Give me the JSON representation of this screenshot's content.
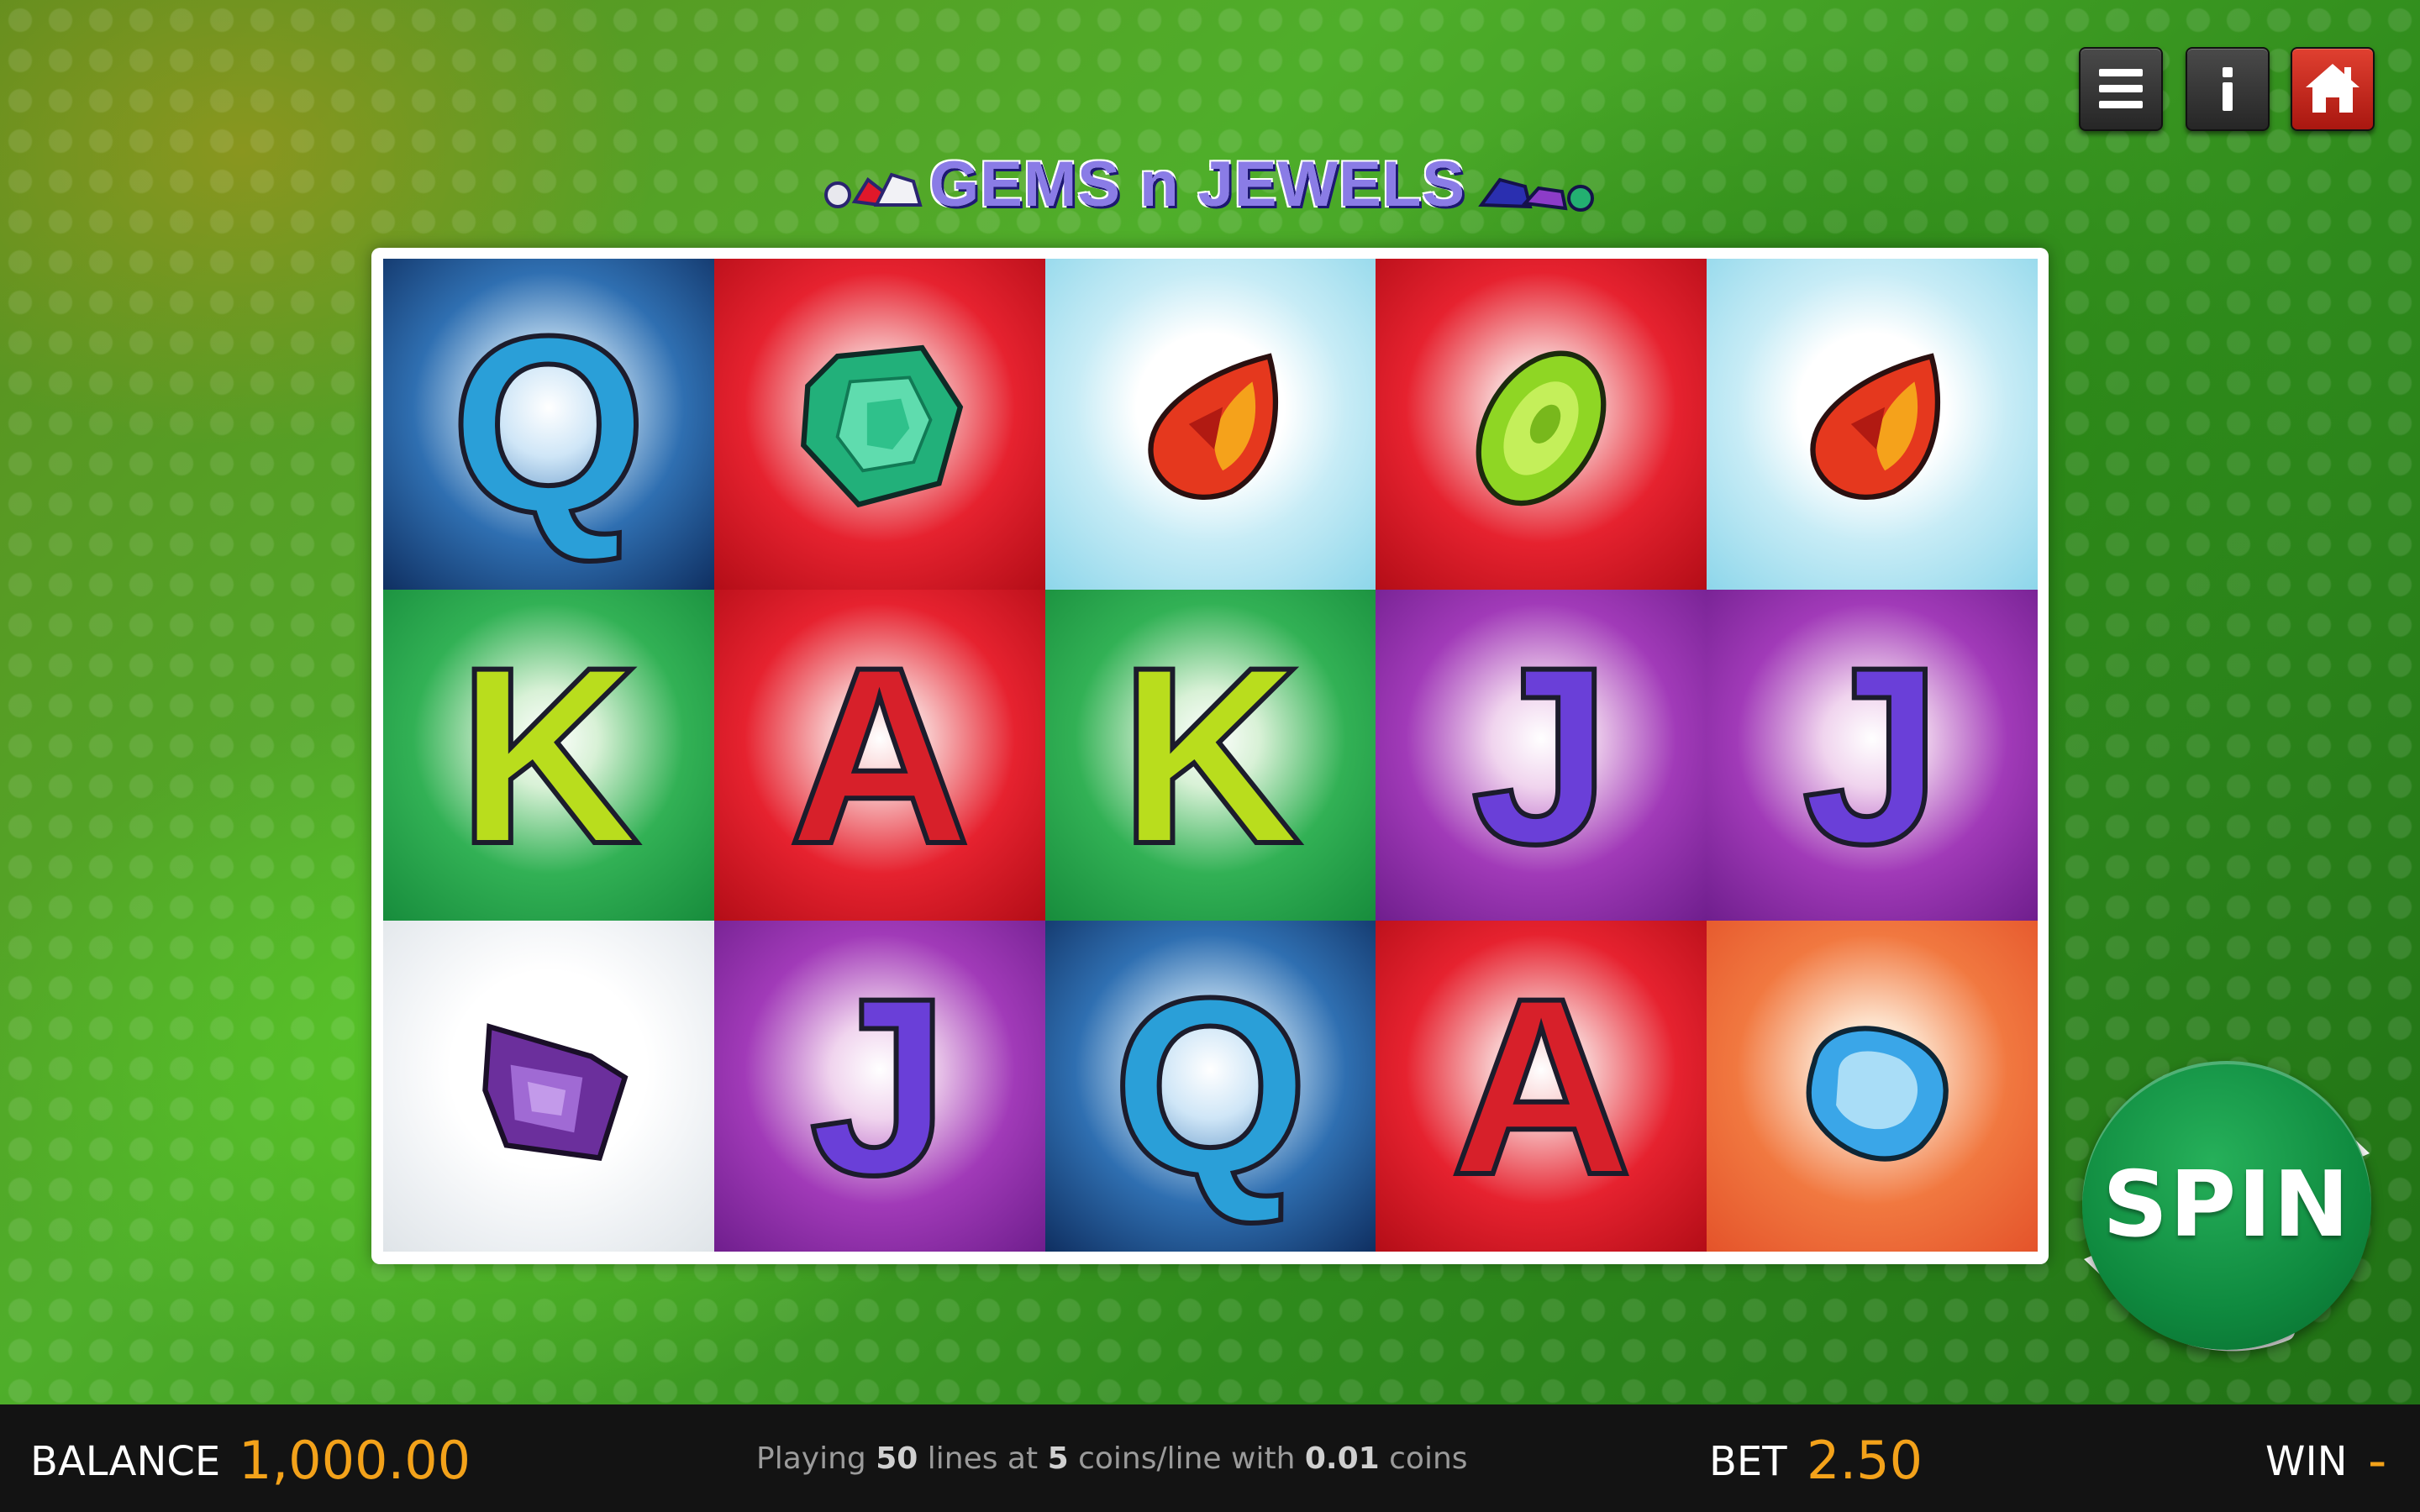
{
  "game": {
    "title": "GEMS n JEWELS"
  },
  "top_buttons": {
    "menu": "menu-icon",
    "info": "info-icon",
    "home": "home-icon",
    "home_color": "#c62018"
  },
  "reels": {
    "rows": [
      [
        {
          "symbol": "Q",
          "bg": "blue"
        },
        {
          "symbol": "emerald",
          "bg": "red"
        },
        {
          "symbol": "ruby-drop",
          "bg": "cyan"
        },
        {
          "symbol": "peridot",
          "bg": "red"
        },
        {
          "symbol": "ruby-drop",
          "bg": "cyan"
        }
      ],
      [
        {
          "symbol": "K",
          "bg": "green"
        },
        {
          "symbol": "A",
          "bg": "red"
        },
        {
          "symbol": "K",
          "bg": "green"
        },
        {
          "symbol": "J",
          "bg": "purple"
        },
        {
          "symbol": "J",
          "bg": "purple"
        }
      ],
      [
        {
          "symbol": "amethyst",
          "bg": "white"
        },
        {
          "symbol": "J",
          "bg": "purple"
        },
        {
          "symbol": "Q",
          "bg": "blue"
        },
        {
          "symbol": "A",
          "bg": "red"
        },
        {
          "symbol": "aquamarine",
          "bg": "orange"
        }
      ]
    ]
  },
  "spin": {
    "label": "SPIN"
  },
  "bottom": {
    "balance_label": "BALANCE",
    "balance_value": "1,000.00",
    "playing_prefix": "Playing",
    "lines": "50",
    "lines_text": "lines at",
    "coins": "5",
    "coins_text": "coins/line with",
    "coin_value": "0.01",
    "coin_value_text": "coins",
    "bet_label": "BET",
    "bet_value": "2.50",
    "win_label": "WIN",
    "win_value": "-"
  },
  "colors": {
    "accent_value": "#f3a21a",
    "spin_green": "#0f8a3f"
  }
}
